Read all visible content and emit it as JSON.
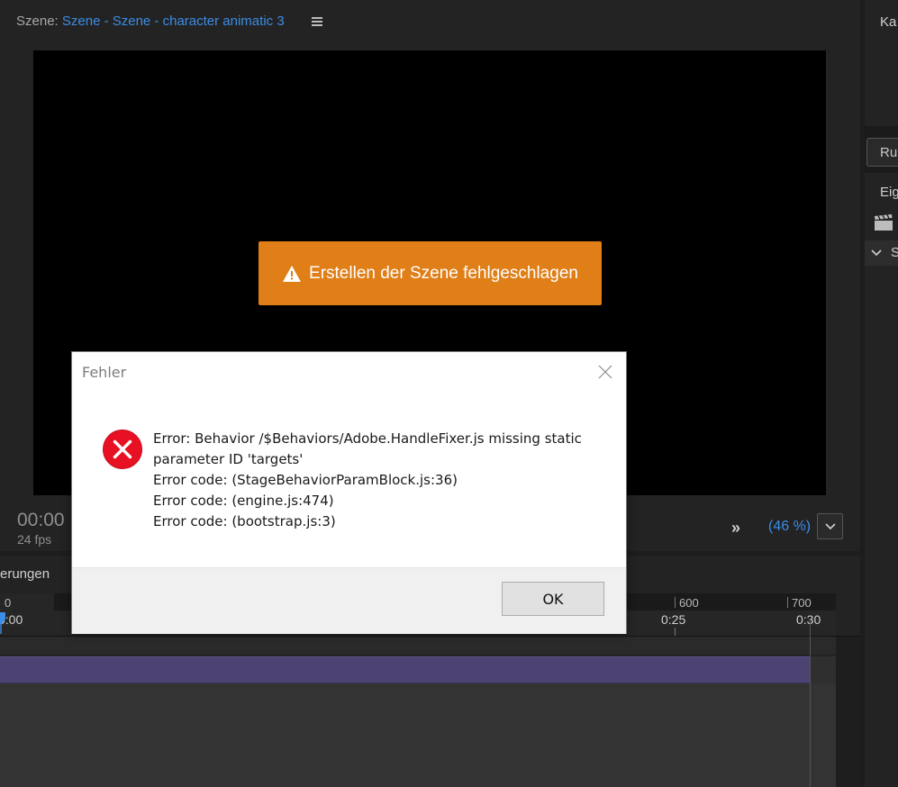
{
  "scene": {
    "label": "Szene:",
    "name": "Szene - Szene - character animatic 3",
    "banner_text": "Erstellen der Szene fehlgeschlagen",
    "timecode": "00:00",
    "fps": "24 fps",
    "forward_glyph": "»",
    "zoom": "(46 %)"
  },
  "right_panel": {
    "top_title": "Ka",
    "button_label": "Ru",
    "props_title": "Eig",
    "row_label": "S"
  },
  "timeline": {
    "title": "erungen",
    "ticks": {
      "frame_0": "0",
      "time_0": "0:00",
      "frame_600": "600",
      "time_25": "0:25",
      "frame_700": "700",
      "time_30": "0:30"
    }
  },
  "dialog": {
    "title": "Fehler",
    "lines": [
      "Error: Behavior /$Behaviors/Adobe.HandleFixer.js missing static",
      "parameter ID 'targets'",
      "Error code: (StageBehaviorParamBlock.js:36)",
      "Error code: (engine.js:474)",
      "Error code: (bootstrap.js:3)"
    ],
    "ok_label": "OK"
  },
  "colors": {
    "accent_blue": "#3b8de5",
    "warning_orange": "#e07e17",
    "clip_purple": "#4c4373",
    "error_red": "#e81123"
  }
}
